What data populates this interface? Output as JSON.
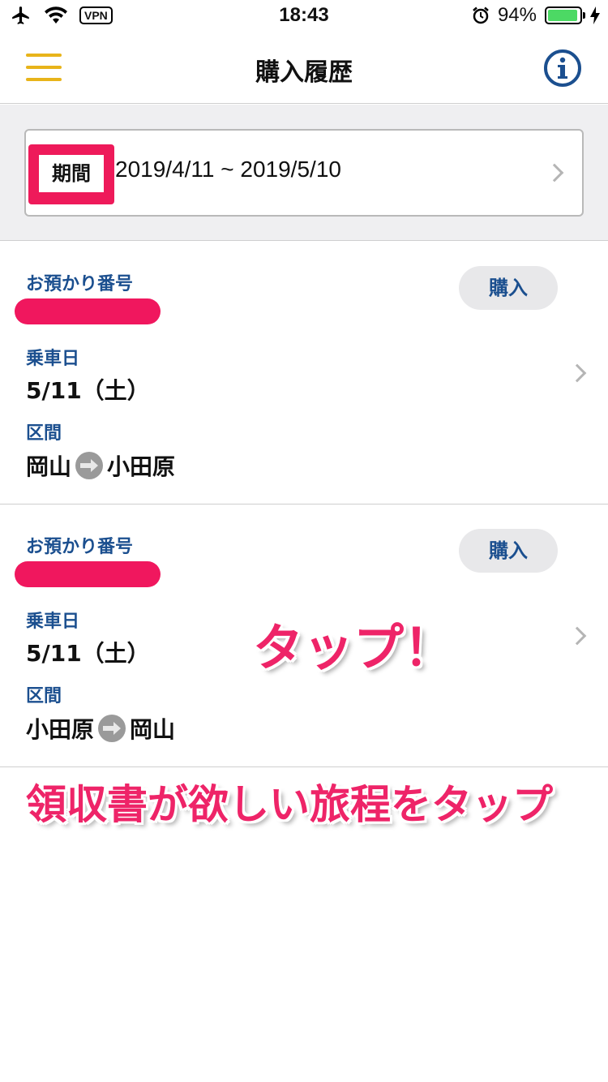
{
  "status_bar": {
    "time": "18:43",
    "vpn": "VPN",
    "battery_text": "94%",
    "battery_level": 0.94,
    "battery_color": "#4cd964"
  },
  "nav": {
    "title": "購入履歴",
    "menu_icon": "hamburger-menu-icon",
    "info_icon": "info-icon",
    "accent_color": "#e8b41a",
    "info_color": "#1b4f8f"
  },
  "period": {
    "label": "期間",
    "value": "2019/4/11 ~ 2019/5/10"
  },
  "trips": [
    {
      "reservation_label": "お預かり番号",
      "buy_label": "購入",
      "date_label": "乗車日",
      "date_value": "5/11（土）",
      "section_label": "区間",
      "from": "岡山",
      "to": "小田原"
    },
    {
      "reservation_label": "お預かり番号",
      "buy_label": "購入",
      "date_label": "乗車日",
      "date_value": "5/11（土）",
      "section_label": "区間",
      "from": "小田原",
      "to": "岡山"
    }
  ],
  "annotations": {
    "tap": "タップ！",
    "hint": "領収書が欲しい旅程をタップ"
  },
  "colors": {
    "highlight": "#ee1a5a",
    "label_blue": "#1b4f8f"
  }
}
